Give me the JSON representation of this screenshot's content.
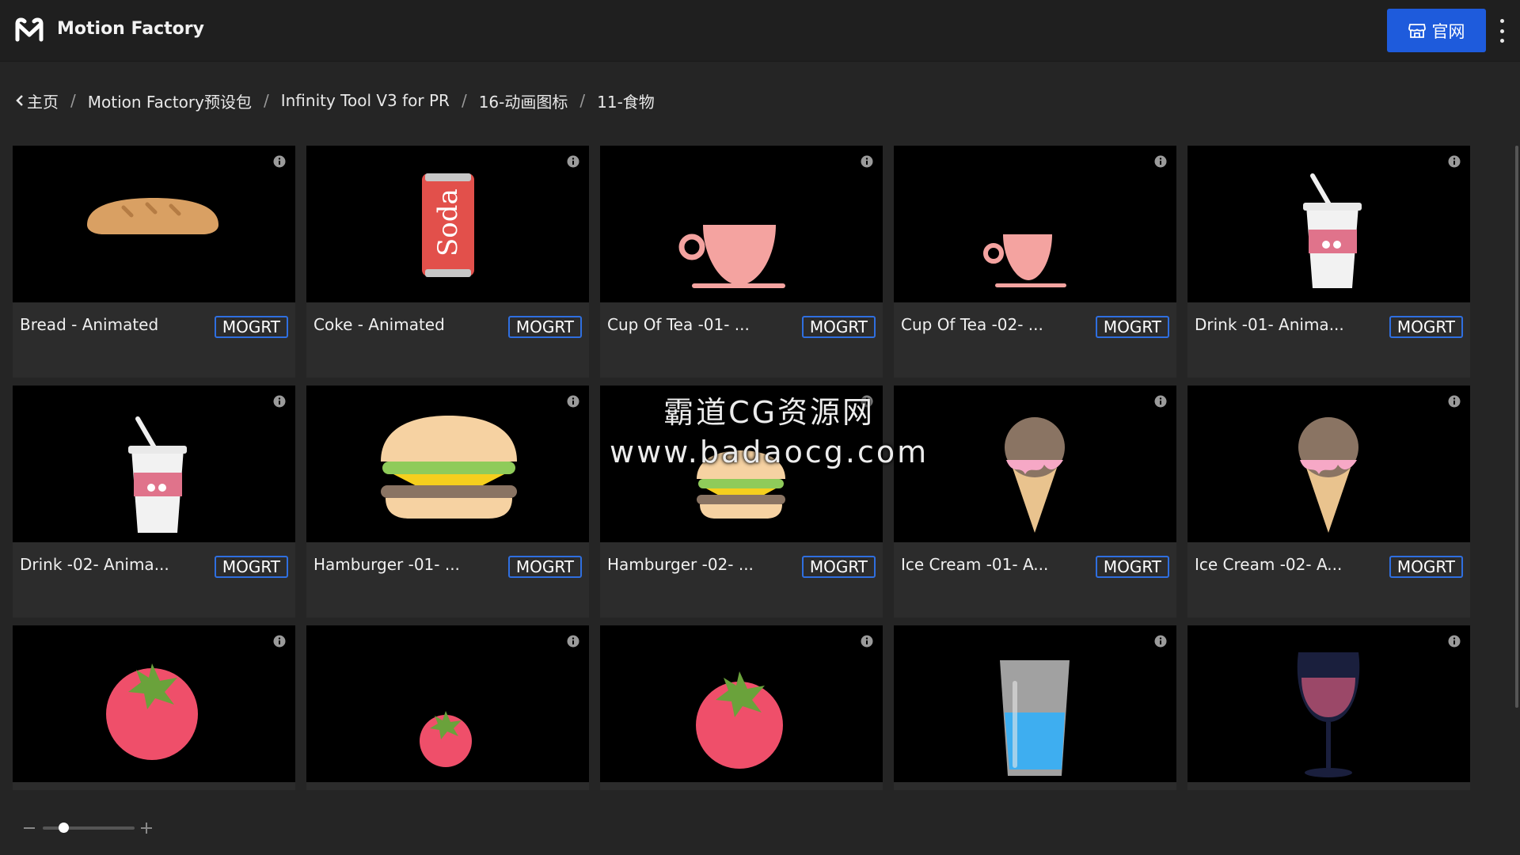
{
  "header": {
    "app_title": "Motion Factory",
    "site_button_label": "官网",
    "brand_color": "#1e5bdc"
  },
  "breadcrumb": [
    "主页",
    "Motion Factory预设包",
    "Infinity Tool V3 for PR",
    "16-动画图标",
    "11-食物"
  ],
  "items": [
    {
      "title": "Bread - Animated",
      "tag": "MOGRT",
      "icon": "bread"
    },
    {
      "title": "Coke - Animated",
      "tag": "MOGRT",
      "icon": "soda-can",
      "can_text": "Soda"
    },
    {
      "title": "Cup Of Tea -01- ...",
      "tag": "MOGRT",
      "icon": "teacup"
    },
    {
      "title": "Cup Of Tea -02- ...",
      "tag": "MOGRT",
      "icon": "teacup-small"
    },
    {
      "title": "Drink -01- Anima...",
      "tag": "MOGRT",
      "icon": "drink-cup"
    },
    {
      "title": "Drink -02- Anima...",
      "tag": "MOGRT",
      "icon": "drink-cup"
    },
    {
      "title": "Hamburger -01- ...",
      "tag": "MOGRT",
      "icon": "hamburger"
    },
    {
      "title": "Hamburger -02- ...",
      "tag": "MOGRT",
      "icon": "hamburger-small"
    },
    {
      "title": "Ice Cream -01- A...",
      "tag": "MOGRT",
      "icon": "ice-cream"
    },
    {
      "title": "Ice Cream -02- A...",
      "tag": "MOGRT",
      "icon": "ice-cream"
    },
    {
      "title": "",
      "tag": "",
      "icon": "tomato"
    },
    {
      "title": "",
      "tag": "",
      "icon": "tomato-small"
    },
    {
      "title": "",
      "tag": "",
      "icon": "tomato"
    },
    {
      "title": "",
      "tag": "",
      "icon": "water-glass"
    },
    {
      "title": "",
      "tag": "",
      "icon": "wine-glass"
    }
  ],
  "watermark": {
    "line1": "霸道CG资源网",
    "line2": "www.badaocg.com"
  }
}
